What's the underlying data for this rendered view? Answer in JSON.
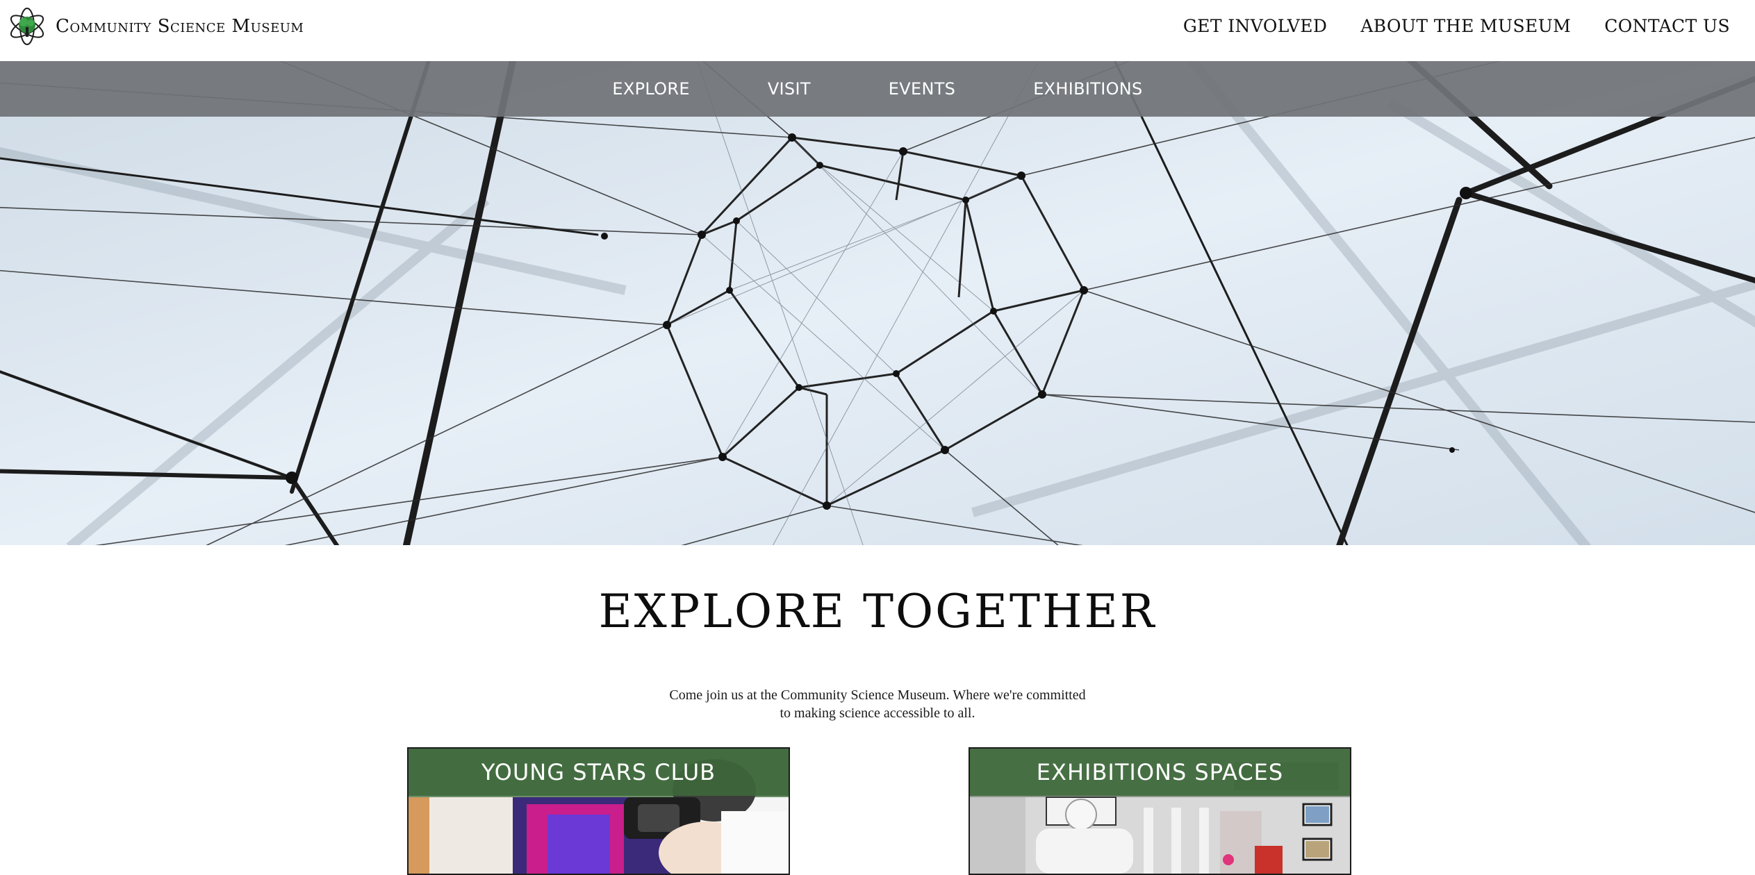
{
  "brand": {
    "name": "Community Science Museum",
    "logo_icon": "atom-tree-logo-icon"
  },
  "utility_nav": [
    "GET INVOLVED",
    "ABOUT THE MUSEUM",
    "CONTACT US"
  ],
  "main_nav": [
    "EXPLORE",
    "VISIT",
    "EVENTS",
    "EXHIBITIONS"
  ],
  "hero": {
    "image": "geometric-string-network-photo"
  },
  "headline": "EXPLORE TOGETHER",
  "intro": "Come join us at the Community Science Museum. Where we're committed to making science accessible to all.",
  "cards": [
    {
      "title": "YOUNG STARS CLUB",
      "image": "child-vr-headset-photo"
    },
    {
      "title": "EXHIBITIONS SPACES",
      "image": "gallery-interior-photo"
    }
  ],
  "colors": {
    "nav_overlay": "#707377",
    "card_title_bg": "#3e693a",
    "logo_green": "#2e8a3a"
  }
}
